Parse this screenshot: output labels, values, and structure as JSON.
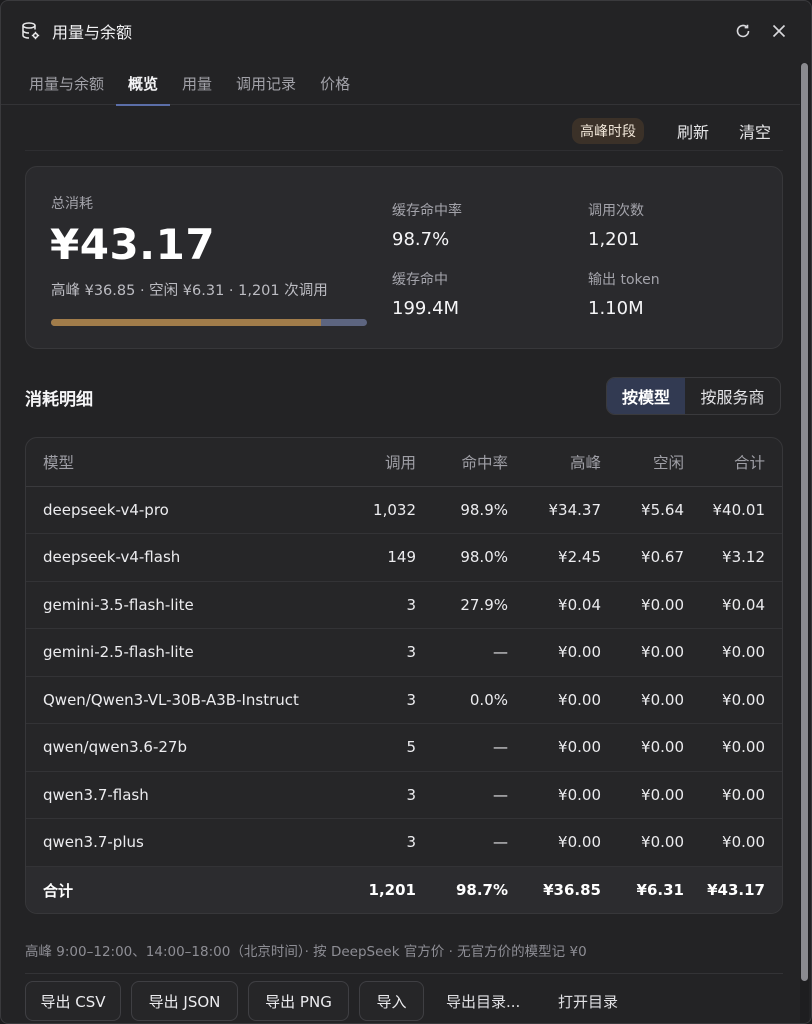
{
  "window": {
    "title": "用量与余额"
  },
  "tabs": [
    {
      "label": "用量与余额",
      "active": false
    },
    {
      "label": "概览",
      "active": true
    },
    {
      "label": "用量",
      "active": false
    },
    {
      "label": "调用记录",
      "active": false
    },
    {
      "label": "价格",
      "active": false
    }
  ],
  "toolbar": {
    "peak_badge": "高峰时段",
    "refresh_label": "刷新",
    "clear_label": "清空"
  },
  "summary": {
    "total_label": "总消耗",
    "total_value": "¥43.17",
    "breakdown": "高峰 ¥36.85 · 空闲 ¥6.31 · 1,201 次调用",
    "peak_share": 0.8536,
    "cache_hit_rate_label": "缓存命中率",
    "cache_hit_rate_value": "98.7%",
    "calls_label": "调用次数",
    "calls_value": "1,201",
    "cache_hit_label": "缓存命中",
    "cache_hit_value": "199.4M",
    "output_token_label": "输出 token",
    "output_token_value": "1.10M"
  },
  "breakdown_section": {
    "title": "消耗明细",
    "by_model_label": "按模型",
    "by_provider_label": "按服务商"
  },
  "table": {
    "headers": {
      "model": "模型",
      "calls": "调用",
      "hit_rate": "命中率",
      "peak": "高峰",
      "idle": "空闲",
      "total": "合计"
    },
    "rows": [
      {
        "model": "deepseek-v4-pro",
        "calls": "1,032",
        "hit_rate": "98.9%",
        "peak": "¥34.37",
        "idle": "¥5.64",
        "total": "¥40.01"
      },
      {
        "model": "deepseek-v4-flash",
        "calls": "149",
        "hit_rate": "98.0%",
        "peak": "¥2.45",
        "idle": "¥0.67",
        "total": "¥3.12"
      },
      {
        "model": "gemini-3.5-flash-lite",
        "calls": "3",
        "hit_rate": "27.9%",
        "peak": "¥0.04",
        "idle": "¥0.00",
        "total": "¥0.04"
      },
      {
        "model": "gemini-2.5-flash-lite",
        "calls": "3",
        "hit_rate": "—",
        "peak": "¥0.00",
        "idle": "¥0.00",
        "total": "¥0.00"
      },
      {
        "model": "Qwen/Qwen3-VL-30B-A3B-Instruct",
        "calls": "3",
        "hit_rate": "0.0%",
        "peak": "¥0.00",
        "idle": "¥0.00",
        "total": "¥0.00"
      },
      {
        "model": "qwen/qwen3.6-27b",
        "calls": "5",
        "hit_rate": "—",
        "peak": "¥0.00",
        "idle": "¥0.00",
        "total": "¥0.00"
      },
      {
        "model": "qwen3.7-flash",
        "calls": "3",
        "hit_rate": "—",
        "peak": "¥0.00",
        "idle": "¥0.00",
        "total": "¥0.00"
      },
      {
        "model": "qwen3.7-plus",
        "calls": "3",
        "hit_rate": "—",
        "peak": "¥0.00",
        "idle": "¥0.00",
        "total": "¥0.00"
      }
    ],
    "total_row": {
      "model": "合计",
      "calls": "1,201",
      "hit_rate": "98.7%",
      "peak": "¥36.85",
      "idle": "¥6.31",
      "total": "¥43.17"
    }
  },
  "footnote": "高峰 9:00–12:00、14:00–18:00（北京时间）· 按 DeepSeek 官方价 · 无官方价的模型记 ¥0",
  "footer": {
    "export_csv": "导出 CSV",
    "export_json": "导出 JSON",
    "export_png": "导出 PNG",
    "import": "导入",
    "export_dir": "导出目录...",
    "open_dir": "打开目录"
  },
  "colors": {
    "accent": "#5b6ea8",
    "peak_bar": "#a17c4a",
    "idle_bar": "#5d6580",
    "peak_badge_bg": "#3b3128"
  },
  "icons": {
    "app": "database-settings-icon",
    "refresh": "refresh-icon",
    "close": "close-icon"
  }
}
